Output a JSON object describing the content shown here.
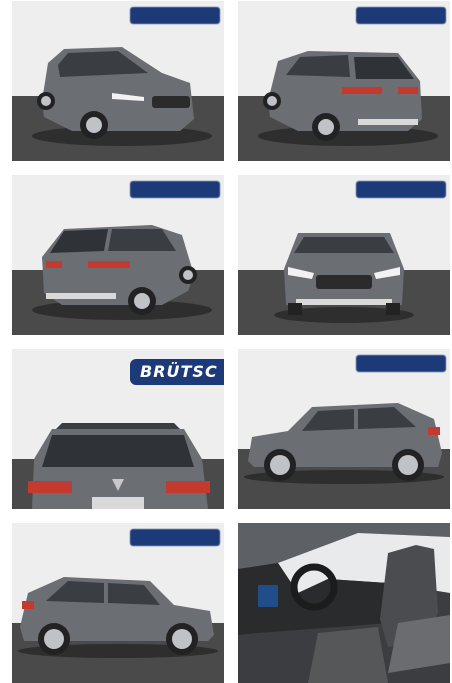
{
  "gallery": {
    "photos": [
      {
        "view": "front-three-quarter-left",
        "icon": "car-front-quarter-photo"
      },
      {
        "view": "rear-three-quarter-left",
        "icon": "car-rear-quarter-photo"
      },
      {
        "view": "rear-three-quarter-right",
        "icon": "car-rear-quarter-photo"
      },
      {
        "view": "front",
        "icon": "car-front-photo"
      },
      {
        "view": "rear",
        "icon": "car-rear-photo",
        "watermark_text": "BRÜTSC"
      },
      {
        "view": "side-right",
        "icon": "car-side-photo"
      },
      {
        "view": "side-left",
        "icon": "car-side-photo"
      },
      {
        "view": "interior",
        "icon": "car-interior-photo"
      }
    ]
  },
  "colors": {
    "car_body": "#6b6e72",
    "floor": "#4a4a4a",
    "wall": "#eeeeee",
    "dealer_badge": "#1d3a78"
  }
}
